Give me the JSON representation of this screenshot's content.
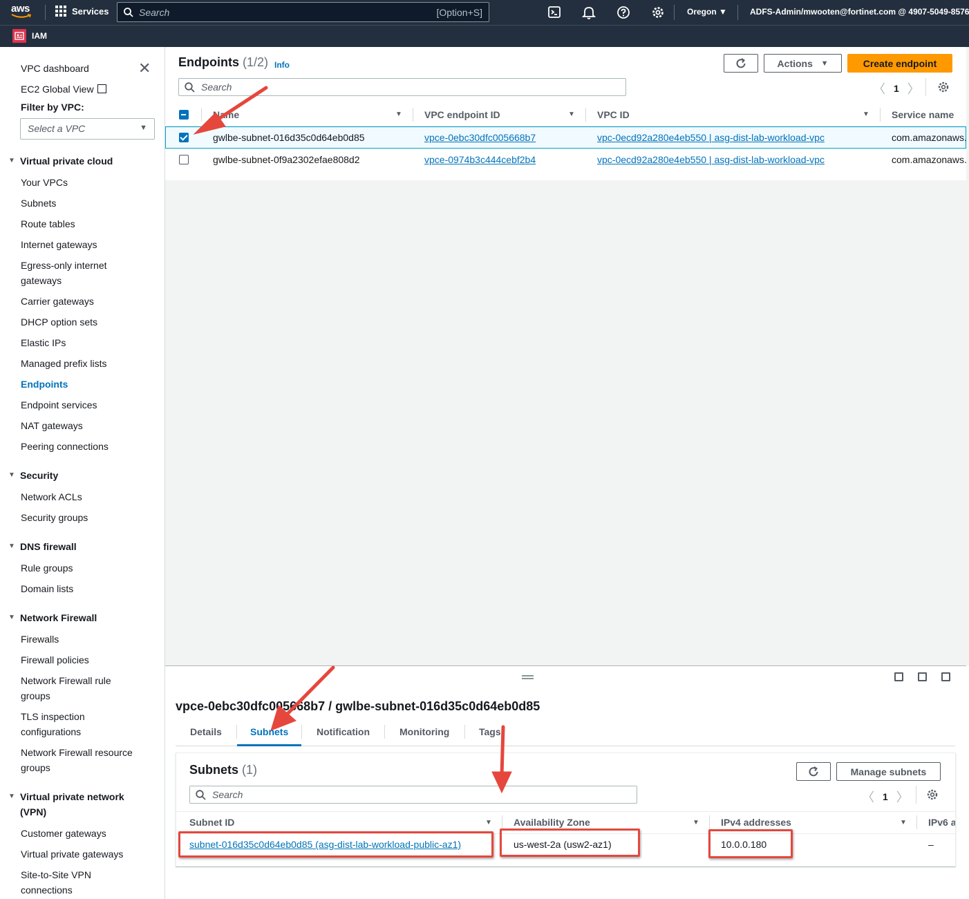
{
  "topnav": {
    "logo": "aws",
    "services": "Services",
    "search_placeholder": "Search",
    "search_shortcut": "[Option+S]",
    "region": "Oregon",
    "account": "ADFS-Admin/mwooten@fortinet.com @ 4907-5049-8576",
    "icons": [
      "cloudshell-icon",
      "bell-icon",
      "help-icon",
      "gear-icon"
    ]
  },
  "subnav": {
    "service": "IAM"
  },
  "sidebar": {
    "top": {
      "vpc_dashboard": "VPC dashboard",
      "ec2_global_view": "EC2 Global View",
      "filter_label": "Filter by VPC:",
      "filter_placeholder": "Select a VPC"
    },
    "sections": [
      {
        "title": "Virtual private cloud",
        "items": [
          "Your VPCs",
          "Subnets",
          "Route tables",
          "Internet gateways",
          "Egress-only internet",
          "gateways",
          "Carrier gateways",
          "DHCP option sets",
          "Elastic IPs",
          "Managed prefix lists",
          "Endpoints",
          "Endpoint services",
          "NAT gateways",
          "Peering connections"
        ]
      },
      {
        "title": "Security",
        "items": [
          "Network ACLs",
          "Security groups"
        ]
      },
      {
        "title": "DNS firewall",
        "items": [
          "Rule groups",
          "Domain lists"
        ]
      },
      {
        "title": "Network Firewall",
        "items": [
          "Firewalls",
          "Firewall policies",
          "Network Firewall rule",
          "groups",
          "TLS inspection",
          "configurations",
          "Network Firewall resource",
          "groups"
        ]
      },
      {
        "title_line1": "Virtual private network",
        "title_line2": "(VPN)",
        "items": [
          "Customer gateways",
          "Virtual private gateways",
          "Site-to-Site VPN",
          "connections"
        ]
      }
    ],
    "active_item": "Endpoints"
  },
  "endpoints": {
    "title": "Endpoints",
    "count": "(1/2)",
    "info": "Info",
    "actions": "Actions",
    "create": "Create endpoint",
    "search_placeholder": "Search",
    "page": "1",
    "columns": [
      "Name",
      "VPC endpoint ID",
      "VPC ID",
      "Service name"
    ],
    "rows": [
      {
        "selected": true,
        "name": "gwlbe-subnet-016d35c0d64eb0d85",
        "endpoint_id": "vpce-0ebc30dfc005668b7",
        "vpc_id": "vpc-0ecd92a280e4eb550 | asg-dist-lab-workload-vpc",
        "service": "com.amazonaws."
      },
      {
        "selected": false,
        "name": "gwlbe-subnet-0f9a2302efae808d2",
        "endpoint_id": "vpce-0974b3c444cebf2b4",
        "vpc_id": "vpc-0ecd92a280e4eb550 | asg-dist-lab-workload-vpc",
        "service": "com.amazonaws."
      }
    ]
  },
  "details": {
    "title": "vpce-0ebc30dfc005668b7 / gwlbe-subnet-016d35c0d64eb0d85",
    "tabs": [
      "Details",
      "Subnets",
      "Notification",
      "Monitoring",
      "Tags"
    ],
    "active_tab": "Subnets",
    "subnets": {
      "title": "Subnets",
      "count": "(1)",
      "manage": "Manage subnets",
      "search_placeholder": "Search",
      "page": "1",
      "columns": [
        "Subnet ID",
        "Availability Zone",
        "IPv4 addresses",
        "IPv6 a"
      ],
      "rows": [
        {
          "subnet_id": "subnet-016d35c0d64eb0d85 (asg-dist-lab-workload-public-az1)",
          "az": "us-west-2a (usw2-az1)",
          "ipv4": "10.0.0.180",
          "ipv6": "–"
        }
      ]
    }
  },
  "colors": {
    "nav_bg": "#232f3e",
    "link": "#0073bb",
    "primary_button": "#ff9900",
    "annotation": "#e5473d"
  }
}
